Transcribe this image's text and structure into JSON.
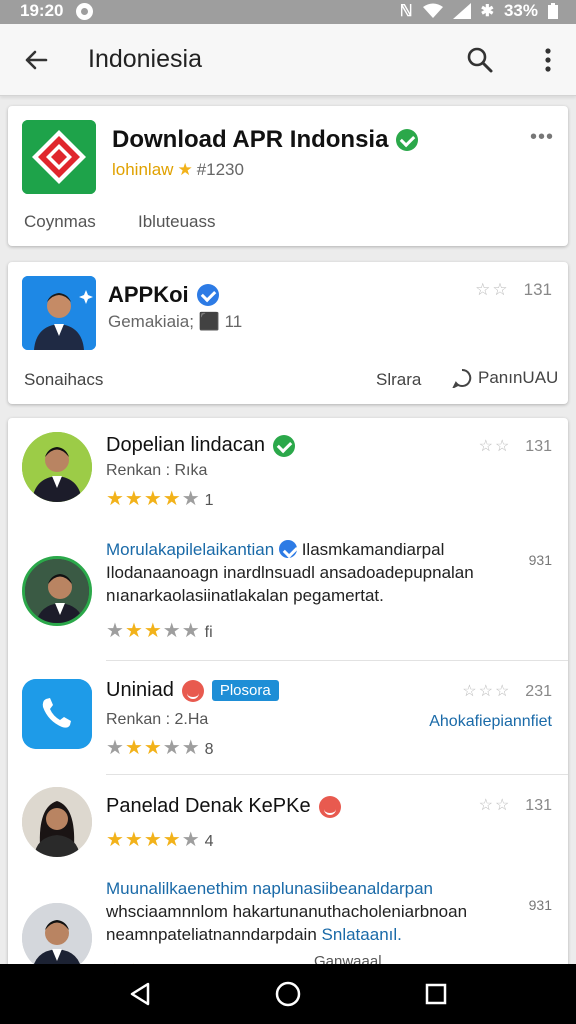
{
  "status_bar": {
    "time": "19:20",
    "battery": "33%"
  },
  "app_bar": {
    "title": "Indoniesia",
    "icons": [
      "back-arrow-icon",
      "search-icon",
      "more-vert-icon"
    ]
  },
  "featured": {
    "name": "Download APR Indonsia",
    "developer": "lohinlaw",
    "count": "#1230",
    "menu": "•••",
    "footer_left": "Coynmas",
    "footer_right": "Ibluteuass"
  },
  "app_card": {
    "name": "APPKoi",
    "sub": "Gemakiaia; ⬛ 11",
    "rating": "131",
    "footer_left": "Sonaihacs",
    "footer_mid": "Slrara",
    "footer_right": "PanınUAU"
  },
  "reviews": [
    {
      "name": "Dopelian lindacan",
      "meta": "Renkan : Rıka",
      "rating": "131",
      "stars": 4,
      "count": "1"
    },
    {
      "line1": "Morulakapilelaikantian",
      "line1_tail": "Ilasmkamandiarpal",
      "line2": "Ilodanaanoagn inardlnsuadl ansadoadepupnalan",
      "line3": "nıanarkaolasiinatlakalan pegamertat.",
      "side": "931",
      "stars": 2,
      "count": "fi"
    },
    {
      "name": "Uniniad",
      "badge": "Plosora",
      "meta": "Renkan : 2.Ha",
      "rating": "231",
      "link": "Ahokafiepiannfiet",
      "stars": 3,
      "count": "8"
    },
    {
      "name": "Panelad Denak KePKe",
      "rating": "131",
      "stars": 4,
      "count": "4"
    },
    {
      "line1": "Muunalilkaenethim naplunasiibeanaldarpan",
      "line2": "whsciaamnnlom hakartunanuthacholeniarbnoan",
      "line3": "neamnpateliatnanndarpdain",
      "line3_hl": "Snlataanıl.",
      "side": "931",
      "footer": "Ganwaaal"
    }
  ],
  "colors": {
    "accent": "#1e88e5",
    "star": "#f2b21a",
    "verified_green": "#2ba84a",
    "verified_blue": "#2d7be5"
  }
}
